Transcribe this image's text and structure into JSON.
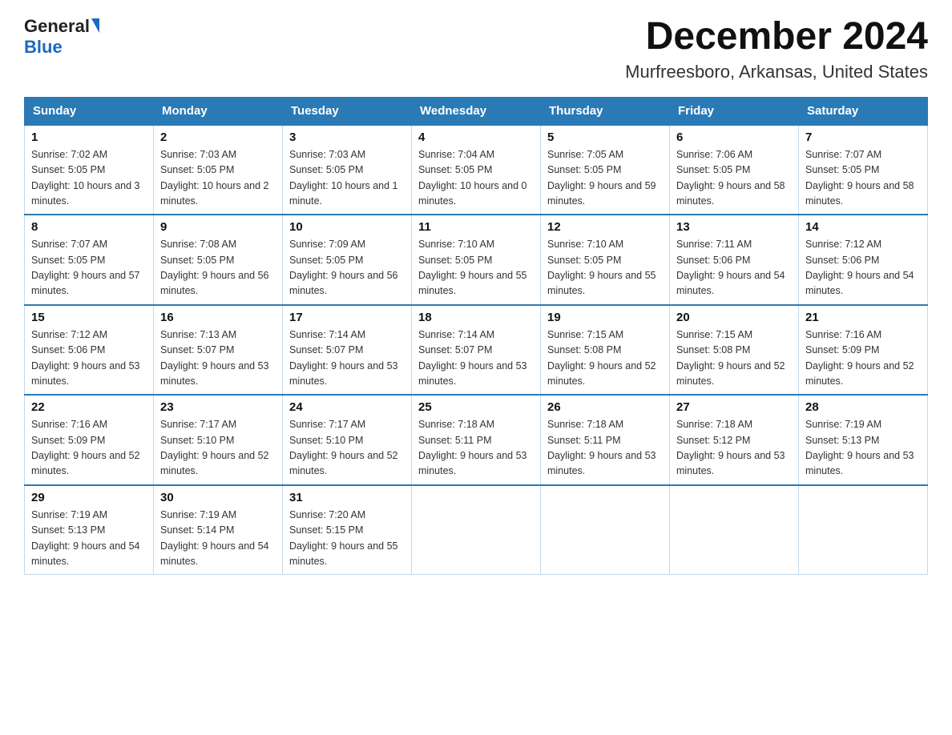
{
  "header": {
    "logo_general": "General",
    "logo_blue": "Blue",
    "main_title": "December 2024",
    "subtitle": "Murfreesboro, Arkansas, United States"
  },
  "days_of_week": [
    "Sunday",
    "Monday",
    "Tuesday",
    "Wednesday",
    "Thursday",
    "Friday",
    "Saturday"
  ],
  "weeks": [
    [
      {
        "day": "1",
        "sunrise": "7:02 AM",
        "sunset": "5:05 PM",
        "daylight": "10 hours and 3 minutes."
      },
      {
        "day": "2",
        "sunrise": "7:03 AM",
        "sunset": "5:05 PM",
        "daylight": "10 hours and 2 minutes."
      },
      {
        "day": "3",
        "sunrise": "7:03 AM",
        "sunset": "5:05 PM",
        "daylight": "10 hours and 1 minute."
      },
      {
        "day": "4",
        "sunrise": "7:04 AM",
        "sunset": "5:05 PM",
        "daylight": "10 hours and 0 minutes."
      },
      {
        "day": "5",
        "sunrise": "7:05 AM",
        "sunset": "5:05 PM",
        "daylight": "9 hours and 59 minutes."
      },
      {
        "day": "6",
        "sunrise": "7:06 AM",
        "sunset": "5:05 PM",
        "daylight": "9 hours and 58 minutes."
      },
      {
        "day": "7",
        "sunrise": "7:07 AM",
        "sunset": "5:05 PM",
        "daylight": "9 hours and 58 minutes."
      }
    ],
    [
      {
        "day": "8",
        "sunrise": "7:07 AM",
        "sunset": "5:05 PM",
        "daylight": "9 hours and 57 minutes."
      },
      {
        "day": "9",
        "sunrise": "7:08 AM",
        "sunset": "5:05 PM",
        "daylight": "9 hours and 56 minutes."
      },
      {
        "day": "10",
        "sunrise": "7:09 AM",
        "sunset": "5:05 PM",
        "daylight": "9 hours and 56 minutes."
      },
      {
        "day": "11",
        "sunrise": "7:10 AM",
        "sunset": "5:05 PM",
        "daylight": "9 hours and 55 minutes."
      },
      {
        "day": "12",
        "sunrise": "7:10 AM",
        "sunset": "5:05 PM",
        "daylight": "9 hours and 55 minutes."
      },
      {
        "day": "13",
        "sunrise": "7:11 AM",
        "sunset": "5:06 PM",
        "daylight": "9 hours and 54 minutes."
      },
      {
        "day": "14",
        "sunrise": "7:12 AM",
        "sunset": "5:06 PM",
        "daylight": "9 hours and 54 minutes."
      }
    ],
    [
      {
        "day": "15",
        "sunrise": "7:12 AM",
        "sunset": "5:06 PM",
        "daylight": "9 hours and 53 minutes."
      },
      {
        "day": "16",
        "sunrise": "7:13 AM",
        "sunset": "5:07 PM",
        "daylight": "9 hours and 53 minutes."
      },
      {
        "day": "17",
        "sunrise": "7:14 AM",
        "sunset": "5:07 PM",
        "daylight": "9 hours and 53 minutes."
      },
      {
        "day": "18",
        "sunrise": "7:14 AM",
        "sunset": "5:07 PM",
        "daylight": "9 hours and 53 minutes."
      },
      {
        "day": "19",
        "sunrise": "7:15 AM",
        "sunset": "5:08 PM",
        "daylight": "9 hours and 52 minutes."
      },
      {
        "day": "20",
        "sunrise": "7:15 AM",
        "sunset": "5:08 PM",
        "daylight": "9 hours and 52 minutes."
      },
      {
        "day": "21",
        "sunrise": "7:16 AM",
        "sunset": "5:09 PM",
        "daylight": "9 hours and 52 minutes."
      }
    ],
    [
      {
        "day": "22",
        "sunrise": "7:16 AM",
        "sunset": "5:09 PM",
        "daylight": "9 hours and 52 minutes."
      },
      {
        "day": "23",
        "sunrise": "7:17 AM",
        "sunset": "5:10 PM",
        "daylight": "9 hours and 52 minutes."
      },
      {
        "day": "24",
        "sunrise": "7:17 AM",
        "sunset": "5:10 PM",
        "daylight": "9 hours and 52 minutes."
      },
      {
        "day": "25",
        "sunrise": "7:18 AM",
        "sunset": "5:11 PM",
        "daylight": "9 hours and 53 minutes."
      },
      {
        "day": "26",
        "sunrise": "7:18 AM",
        "sunset": "5:11 PM",
        "daylight": "9 hours and 53 minutes."
      },
      {
        "day": "27",
        "sunrise": "7:18 AM",
        "sunset": "5:12 PM",
        "daylight": "9 hours and 53 minutes."
      },
      {
        "day": "28",
        "sunrise": "7:19 AM",
        "sunset": "5:13 PM",
        "daylight": "9 hours and 53 minutes."
      }
    ],
    [
      {
        "day": "29",
        "sunrise": "7:19 AM",
        "sunset": "5:13 PM",
        "daylight": "9 hours and 54 minutes."
      },
      {
        "day": "30",
        "sunrise": "7:19 AM",
        "sunset": "5:14 PM",
        "daylight": "9 hours and 54 minutes."
      },
      {
        "day": "31",
        "sunrise": "7:20 AM",
        "sunset": "5:15 PM",
        "daylight": "9 hours and 55 minutes."
      },
      null,
      null,
      null,
      null
    ]
  ],
  "labels": {
    "sunrise": "Sunrise:",
    "sunset": "Sunset:",
    "daylight": "Daylight:"
  }
}
